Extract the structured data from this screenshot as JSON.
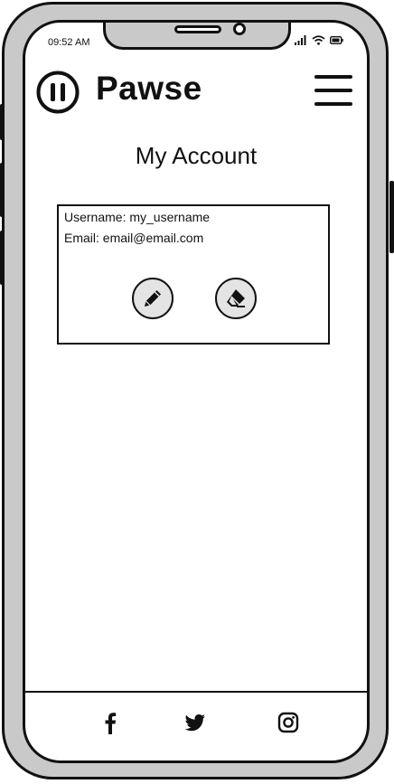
{
  "status_bar": {
    "time": "09:52 AM"
  },
  "header": {
    "app_name": "Pawse",
    "logo_icon": "pause-circle-icon",
    "menu_icon": "hamburger-menu-icon"
  },
  "page": {
    "title": "My Account"
  },
  "account": {
    "username_line": "Username: my_username",
    "email_line": "Email: email@email.com",
    "edit_icon": "pencil-icon",
    "delete_icon": "eraser-icon"
  },
  "footer": {
    "social": [
      "facebook-icon",
      "twitter-icon",
      "instagram-icon"
    ]
  },
  "colors": {
    "ink": "#111111",
    "frame_gray": "#c9c9c9",
    "button_fill": "#e4e4e4"
  }
}
